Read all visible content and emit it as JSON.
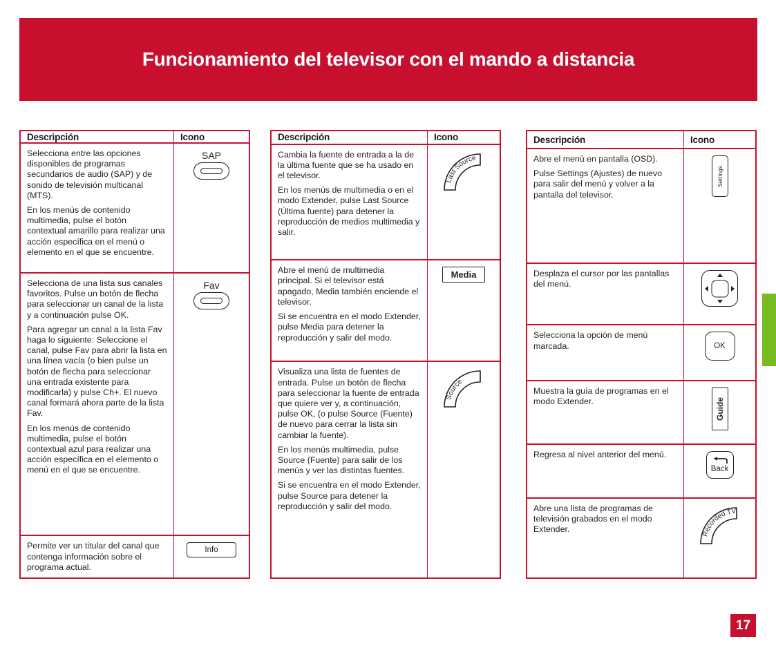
{
  "page": {
    "title": "Funcionamiento del televisor con el mando a distancia",
    "number": "17",
    "banner_color": "#c8102e",
    "tab_color": "#76bc21"
  },
  "columns": [
    {
      "headers": {
        "description": "Descripción",
        "icon": "Icono"
      },
      "rows": [
        {
          "paragraphs": [
            "Selecciona entre las opciones disponibles de programas secundarios de audio (SAP) y de sonido de televisión multicanal (MTS).",
            "En los menús de contenido multimedia, pulse el botón contextual amarillo para realizar una acción específica en el menú o elemento en el que se encuentre."
          ],
          "icon": {
            "type": "pill-key",
            "label": "SAP"
          }
        },
        {
          "paragraphs": [
            "Selecciona de una lista sus canales favoritos. Pulse un botón de flecha para seleccionar un canal de la lista y a continuación pulse OK.",
            "Para agregar un canal a la lista Fav haga lo siguiente: Seleccione el canal, pulse Fav para abrir la lista en una línea vacía (o bien pulse un botón de flecha para seleccionar una entrada existente para modificarla) y pulse Ch+. El nuevo canal formará ahora parte de la lista Fav.",
            "En los menús de contenido multimedia, pulse el botón contextual azul para realizar una acción específica en el elemento o menú en el que se encuentre."
          ],
          "icon": {
            "type": "pill-key",
            "label": "Fav"
          }
        },
        {
          "paragraphs": [
            "Permite ver un titular del canal que contenga información sobre el programa actual."
          ],
          "icon": {
            "type": "rect-key",
            "label": "Info"
          }
        }
      ]
    },
    {
      "headers": {
        "description": "Descripción",
        "icon": "Icono"
      },
      "rows": [
        {
          "paragraphs": [
            "Cambia la fuente de entrada a la de la última fuente que se ha usado en el televisor.",
            "En los menús de multimedia o en el modo Extender, pulse Last Source (Última fuente) para detener la reproducción de medios multimedia y salir."
          ],
          "icon": {
            "type": "arc-key",
            "label": "Last Source"
          }
        },
        {
          "paragraphs": [
            "Abre el menú de multimedia principal. Si el televisor está apagado, Media también enciende el televisor.",
            "Si se encuentra en el modo Extender, pulse Media para detener la reproducción y salir del modo."
          ],
          "icon": {
            "type": "rect-key-bold",
            "label": "Media"
          }
        },
        {
          "paragraphs": [
            "Visualiza una lista de fuentes de entrada. Pulse un botón de flecha para seleccionar la fuente de entrada que quiere ver y, a continuación, pulse OK, (o pulse Source (Fuente) de nuevo para cerrar la lista sin cambiar la fuente).",
            "En los menús multimedia, pulse Source (Fuente) para salir de los menús y ver las distintas fuentes.",
            "Si se encuentra en el modo Extender, pulse Source para detener la reproducción y salir del modo."
          ],
          "icon": {
            "type": "arc-key",
            "label": "Source"
          }
        }
      ]
    },
    {
      "headers": {
        "description": "Descripción",
        "icon": "Icono"
      },
      "rows": [
        {
          "paragraphs": [
            "Abre el menú en pantalla (OSD).",
            "Pulse Settings (Ajustes) de nuevo para salir del menú y volver a la pantalla del televisor."
          ],
          "icon": {
            "type": "vert-key-settings",
            "label": "Settings"
          }
        },
        {
          "paragraphs": [
            "Desplaza el cursor por las pantallas del menú."
          ],
          "icon": {
            "type": "dpad-key",
            "label": ""
          }
        },
        {
          "paragraphs": [
            "Selecciona la opción de menú marcada."
          ],
          "icon": {
            "type": "ok-key",
            "label": "OK"
          }
        },
        {
          "paragraphs": [
            "Muestra la guía de programas en el modo Extender."
          ],
          "icon": {
            "type": "vert-key-guide",
            "label": "Guide"
          }
        },
        {
          "paragraphs": [
            "Regresa al nivel anterior del menú."
          ],
          "icon": {
            "type": "back-key",
            "label": "Back"
          }
        },
        {
          "paragraphs": [
            "Abre una lista de programas de televisión grabados en el modo Extender."
          ],
          "icon": {
            "type": "arc-key",
            "label": "Recorded TV"
          }
        }
      ]
    }
  ]
}
